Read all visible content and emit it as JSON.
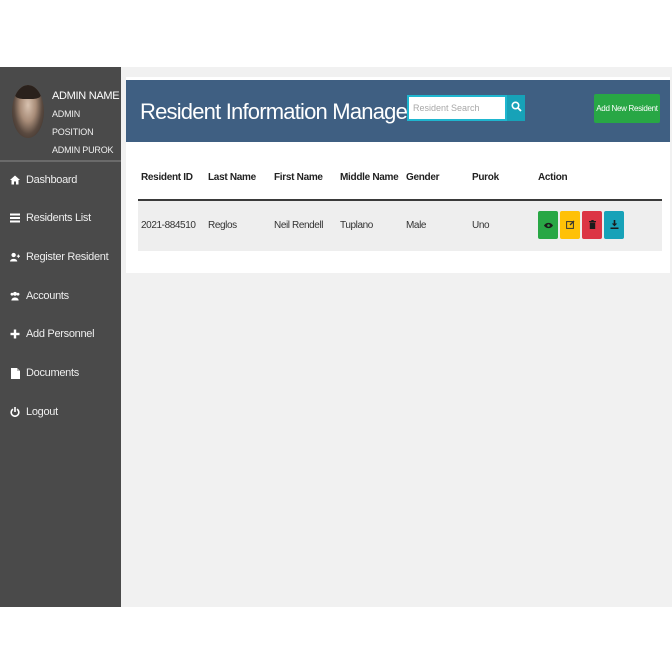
{
  "sidebar": {
    "admin_name": "ADMIN NAME",
    "admin_position": "ADMIN POSITION",
    "admin_purok": "ADMIN PUROK",
    "items": [
      {
        "label": "Dashboard",
        "icon": "home-icon"
      },
      {
        "label": "Residents List",
        "icon": "list-icon"
      },
      {
        "label": "Register Resident",
        "icon": "user-plus-icon"
      },
      {
        "label": "Accounts",
        "icon": "users-icon"
      },
      {
        "label": "Add Personnel",
        "icon": "plus-icon"
      },
      {
        "label": "Documents",
        "icon": "file-icon"
      },
      {
        "label": "Logout",
        "icon": "power-icon"
      }
    ]
  },
  "header": {
    "title": "Resident Information Management",
    "search_placeholder": "Resident Search",
    "add_button_label": "Add New Resident"
  },
  "table": {
    "columns": [
      "Resident ID",
      "Last Name",
      "First Name",
      "Middle Name",
      "Gender",
      "Purok",
      "Action"
    ],
    "rows": [
      {
        "resident_id": "2021-884510",
        "last_name": "Reglos",
        "first_name": "Neil Rendell",
        "middle_name": "Tuplano",
        "gender": "Male",
        "purok": "Uno"
      }
    ],
    "actions": [
      {
        "name": "view",
        "icon": "eye-icon",
        "color": "#28a745"
      },
      {
        "name": "edit",
        "icon": "edit-icon",
        "color": "#ffc107"
      },
      {
        "name": "delete",
        "icon": "trash-icon",
        "color": "#dc3545"
      },
      {
        "name": "download",
        "icon": "download-icon",
        "color": "#17a2b8"
      }
    ]
  },
  "colors": {
    "sidebar": "#4a4a4a",
    "header": "#3f5f82",
    "accent": "#17a2b8",
    "add_button": "#28a745"
  }
}
